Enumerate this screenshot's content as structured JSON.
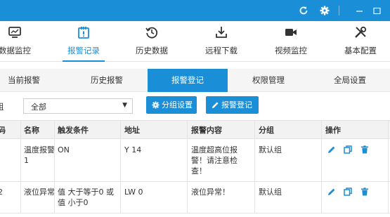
{
  "titlebar": {
    "refresh_icon": "refresh-icon",
    "settings_icon": "gear-icon",
    "minimize_icon": "minimize-icon",
    "maximize_icon": "maximize-icon"
  },
  "nav": {
    "items": [
      {
        "label": "数据监控",
        "icon": "monitor-icon"
      },
      {
        "label": "报警记录",
        "icon": "clipboard-alert-icon"
      },
      {
        "label": "历史数据",
        "icon": "history-icon"
      },
      {
        "label": "远程下载",
        "icon": "download-icon"
      },
      {
        "label": "视频监控",
        "icon": "video-camera-icon"
      },
      {
        "label": "基本配置",
        "icon": "tools-icon"
      }
    ],
    "active": "报警记录"
  },
  "subtabs": [
    "当前报警",
    "历史报警",
    "报警登记",
    "权限管理",
    "全局设置"
  ],
  "active_subtab": "报警登记",
  "toolbar": {
    "group_label": "组",
    "group_select": "全部",
    "group_settings_button": "分组设置",
    "register_button": "报警登记"
  },
  "table": {
    "headers": [
      "码",
      "名称",
      "触发条件",
      "地址",
      "报警内容",
      "分组",
      "操作"
    ],
    "rows": [
      {
        "code": "",
        "name": "温度报警1",
        "condition": "ON",
        "address": "Y 14",
        "content": "温度超高位报警！请注意检查！",
        "group": "默认组"
      },
      {
        "code": "2",
        "name": "液位异常",
        "condition": "值 大于等于0 或 值 小于0",
        "address": "LW 0",
        "content": "液位异常！",
        "group": "默认组"
      }
    ],
    "actions": [
      "edit-icon",
      "copy-icon",
      "delete-icon"
    ]
  },
  "colors": {
    "primary": "#1a8fd8",
    "header_bg": "#f2f2f2",
    "subtab_bg": "#f5f5f5"
  }
}
